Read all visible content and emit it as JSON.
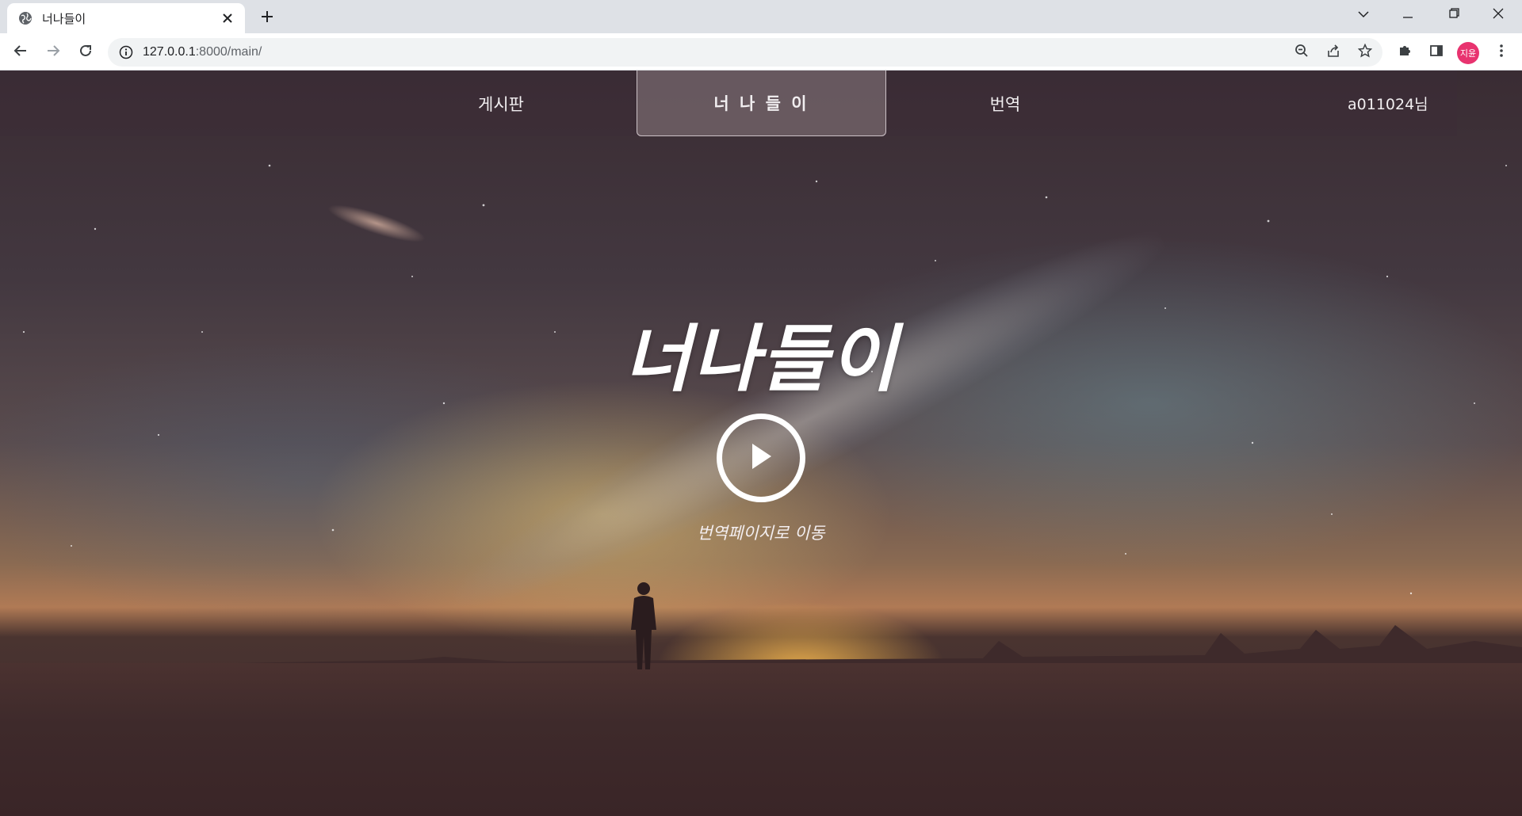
{
  "browser": {
    "tab_title": "너나들이",
    "url_host": "127.0.0.1",
    "url_rest": ":8000/main/",
    "profile_initials": "지윤",
    "profile_color": "#e8336f"
  },
  "nav": {
    "items": [
      {
        "label": "게시판"
      },
      {
        "label": "너 나 들 이"
      },
      {
        "label": "번역"
      }
    ],
    "user_label": "a011024님"
  },
  "hero": {
    "title": "너나들이",
    "play_caption": "번역페이지로 이동"
  },
  "icons": [
    "globe-icon",
    "close-icon",
    "plus-icon",
    "chevron-down-icon",
    "minimize-icon",
    "restore-icon",
    "window-close-icon",
    "back-arrow-icon",
    "forward-arrow-icon",
    "reload-icon",
    "info-icon",
    "zoom-icon",
    "share-icon",
    "star-icon",
    "puzzle-icon",
    "side-panel-icon",
    "kebab-menu-icon",
    "play-icon"
  ]
}
